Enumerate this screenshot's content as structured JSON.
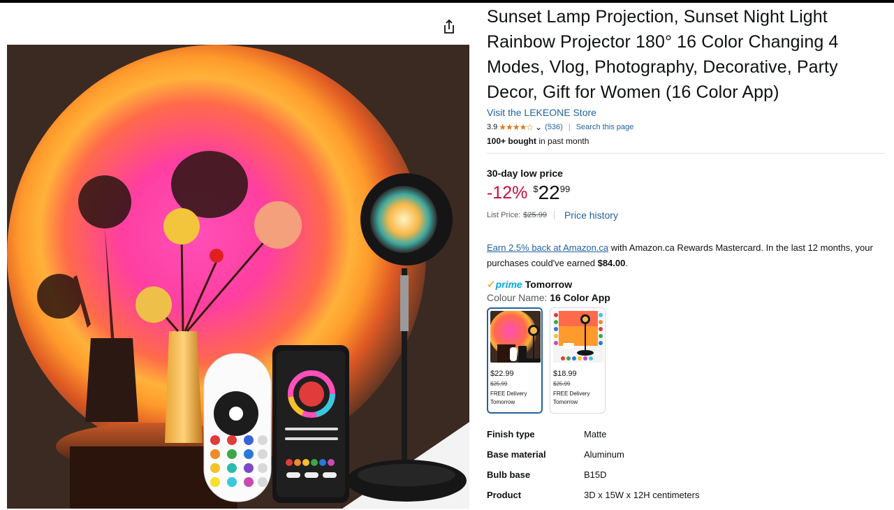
{
  "product": {
    "title": "Sunset Lamp Projection, Sunset Night Light Rainbow Projector 180° 16 Color Changing 4 Modes, Vlog, Photography, Decorative, Party Decor, Gift for Women (16 Color App)",
    "store_link": "Visit the LEKEONE Store",
    "rating_value": "3.9",
    "rating_stars": "★★★★☆",
    "rating_count": "(536)",
    "search_page": "Search this page",
    "bought_bold": "100+ bought",
    "bought_rest": " in past month"
  },
  "pricing": {
    "low_label": "30-day low price",
    "discount": "-12%",
    "currency": "$",
    "whole": "22",
    "fraction": "99",
    "list_label": "List Price:",
    "list_price": "$25.99",
    "history_link": "Price history"
  },
  "rewards": {
    "link": "Earn 2.5% back at Amazon.ca",
    "text": " with Amazon.ca Rewards Mastercard. In the last 12 months, your purchases could've earned ",
    "amount": "$84.00",
    "end": "."
  },
  "delivery": {
    "prime_check": "✓",
    "prime": "prime",
    "when": "Tomorrow"
  },
  "colour": {
    "label": "Colour Name: ",
    "selected": "16 Color App"
  },
  "swatches": [
    {
      "price": "$22.99",
      "was": "$25.99",
      "delivery": "FREE Delivery",
      "when": "Tomorrow"
    },
    {
      "price": "$18.99",
      "was": "$25.99",
      "delivery": "FREE Delivery",
      "when": "Tomorrow"
    }
  ],
  "specs": [
    {
      "key": "Finish type",
      "value": "Matte"
    },
    {
      "key": "Base material",
      "value": "Aluminum"
    },
    {
      "key": "Bulb base",
      "value": "B15D"
    },
    {
      "key": "Product",
      "value": "3D x 15W x 12H centimeters"
    }
  ],
  "icons": {
    "share": "share-icon",
    "chevron": "chevron-down-icon"
  },
  "colors": {
    "link": "#2162a1",
    "discount": "#cc0c39",
    "star": "#de7921",
    "prime": "#00a8e1"
  }
}
